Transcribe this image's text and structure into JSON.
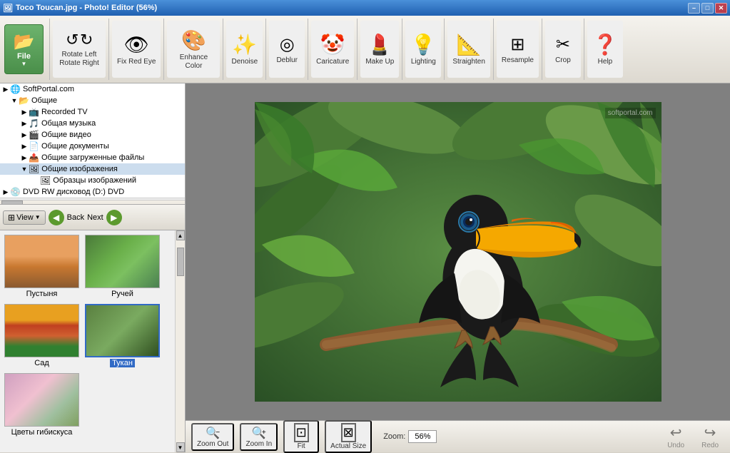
{
  "window": {
    "title": "Toco Toucan.jpg - Photo! Editor (56%)",
    "icon": "🖼"
  },
  "titlebar": {
    "minimize_label": "–",
    "maximize_label": "□",
    "close_label": "✕"
  },
  "toolbar": {
    "file_label": "File",
    "rotate_label": "Rotate Left Rotate Right",
    "redeye_label": "Fix Red Eye",
    "enhance_label": "Enhance Color",
    "denoise_label": "Denoise",
    "deblur_label": "Deblur",
    "caricature_label": "Caricature",
    "makeup_label": "Make Up",
    "lighting_label": "Lighting",
    "straighten_label": "Straighten",
    "resample_label": "Resample",
    "crop_label": "Crop",
    "help_label": "Help"
  },
  "filetree": {
    "items": [
      {
        "label": "SoftPortal.com",
        "icon": "globe",
        "level": 0,
        "expand": true
      },
      {
        "label": "Общие",
        "icon": "folder",
        "level": 1,
        "expand": true
      },
      {
        "label": "Recorded TV",
        "icon": "tv",
        "level": 2,
        "expand": true
      },
      {
        "label": "Общая музыка",
        "icon": "music",
        "level": 2,
        "expand": false
      },
      {
        "label": "Общие видео",
        "icon": "video",
        "level": 2,
        "expand": false
      },
      {
        "label": "Общие документы",
        "icon": "doc",
        "level": 2,
        "expand": false
      },
      {
        "label": "Общие загруженные файлы",
        "icon": "upload",
        "level": 2,
        "expand": false
      },
      {
        "label": "Общие изображения",
        "icon": "image",
        "level": 2,
        "expand": true
      },
      {
        "label": "Образцы изображений",
        "icon": "image",
        "level": 3,
        "expand": false
      },
      {
        "label": "DVD RW дисковод (D:) DVD",
        "icon": "disc",
        "level": 0,
        "expand": false
      }
    ]
  },
  "nav": {
    "view_label": "View",
    "back_label": "Back",
    "next_label": "Next"
  },
  "thumbnails": [
    {
      "label": "Пустыня",
      "type": "desert",
      "selected": false
    },
    {
      "label": "Ручей",
      "type": "stream",
      "selected": false
    },
    {
      "label": "Сад",
      "type": "garden",
      "selected": false
    },
    {
      "label": "Тукан",
      "type": "toucan",
      "selected": true
    },
    {
      "label": "Цветы гибискуса",
      "type": "hibiscus",
      "selected": false
    }
  ],
  "zoom": {
    "label": "Zoom:",
    "value": "56%",
    "zoom_out_label": "Zoom Out",
    "zoom_in_label": "Zoom In",
    "fit_label": "Fit",
    "actual_label": "Actual Size"
  },
  "history": {
    "undo_label": "Undo",
    "redo_label": "Redo"
  },
  "watermark": "softportal.com"
}
